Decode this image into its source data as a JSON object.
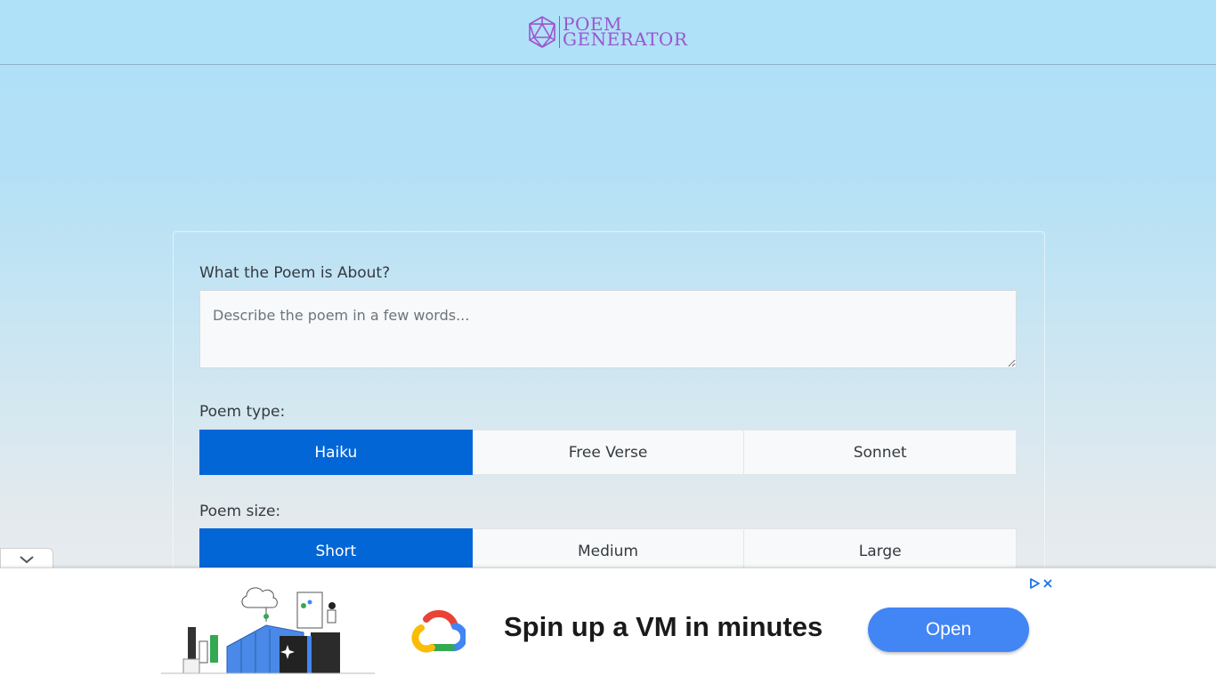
{
  "header": {
    "logo_line1": "POEM",
    "logo_line2": "GENERATOR"
  },
  "form": {
    "about_label": "What the Poem is About?",
    "about_placeholder": "Describe the poem in a few words...",
    "type_label": "Poem type:",
    "type_options": [
      "Haiku",
      "Free Verse",
      "Sonnet"
    ],
    "type_selected": "Haiku",
    "size_label": "Poem size:",
    "size_options": [
      "Short",
      "Medium",
      "Large"
    ],
    "size_selected": "Short"
  },
  "ad": {
    "headline": "Spin up a VM in minutes",
    "cta": "Open"
  },
  "colors": {
    "accent": "#0366d6",
    "logo": "#9b55cf",
    "ad_button": "#4285f4"
  },
  "icons": [
    "logo-icosahedron-icon",
    "chevron-down-icon",
    "google-cloud-icon",
    "adchoices-icon",
    "close-icon"
  ]
}
